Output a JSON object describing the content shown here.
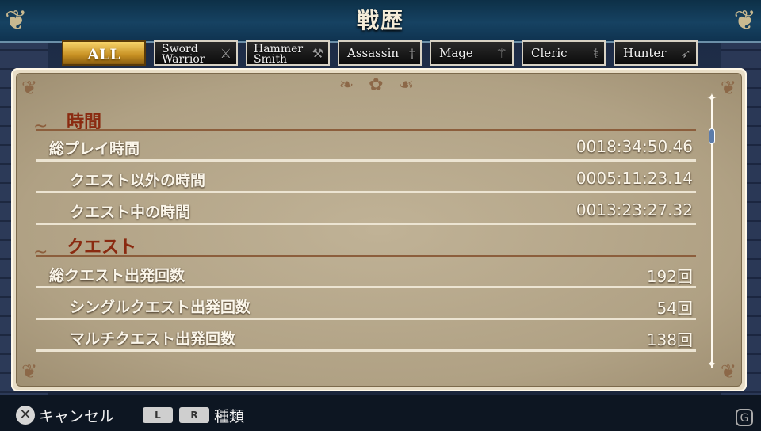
{
  "header": {
    "title": "戦歴"
  },
  "tabs": [
    {
      "label": "ALL",
      "active": true
    },
    {
      "line1": "Sword",
      "line2": "Warrior",
      "icon": "sword-icon"
    },
    {
      "line1": "Hammer",
      "line2": "Smith",
      "icon": "hammer-icon"
    },
    {
      "label": "Assassin",
      "icon": "dagger-icon"
    },
    {
      "label": "Mage",
      "icon": "staff-icon"
    },
    {
      "label": "Cleric",
      "icon": "mace-icon"
    },
    {
      "label": "Hunter",
      "icon": "bow-icon"
    }
  ],
  "sections": {
    "time": {
      "heading": "時間",
      "rows": [
        {
          "label": "総プレイ時間",
          "value": "0018:34:50.46"
        },
        {
          "label": "クエスト以外の時間",
          "value": "0005:11:23.14"
        },
        {
          "label": "クエスト中の時間",
          "value": "0013:23:27.32"
        }
      ]
    },
    "quest": {
      "heading": "クエスト",
      "rows": [
        {
          "label": "総クエスト出発回数",
          "value": "192回"
        },
        {
          "label": "シングルクエスト出発回数",
          "value": "54回"
        },
        {
          "label": "マルチクエスト出発回数",
          "value": "138回"
        }
      ]
    }
  },
  "footer": {
    "cancel_label": "キャンセル",
    "l_button": "L",
    "r_button": "R",
    "kind_label": "種類"
  },
  "colors": {
    "accent_tab": "#e0a830",
    "panel": "#b8a98c",
    "heading": "#8a2a10"
  }
}
